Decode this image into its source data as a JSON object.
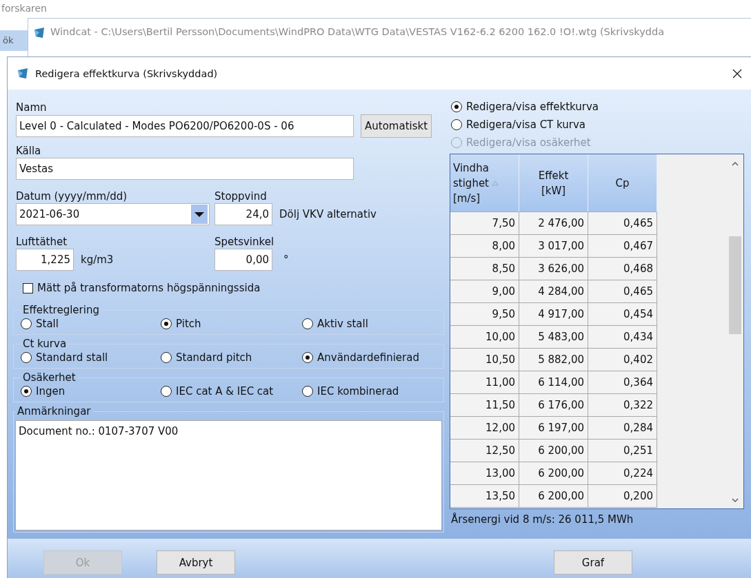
{
  "background": {
    "app_text": "forskaren",
    "side_text": "ök",
    "window_title": "Windcat - C:\\Users\\Bertil Persson\\Documents\\WindPRO Data\\WTG Data\\VESTAS V162-6.2 6200 162.0 !O!.wtg  (Skrivskydda"
  },
  "dialog": {
    "title": "Redigera effektkurva (Skrivskyddad)"
  },
  "name": {
    "label": "Namn",
    "value": "Level 0 - Calculated - Modes PO6200/PO6200-0S - 06",
    "button": "Automatiskt"
  },
  "source": {
    "label": "Källa",
    "value": "Vestas"
  },
  "date": {
    "label": "Datum (yyyy/mm/dd)",
    "value": "2021-06-30"
  },
  "stop_wind": {
    "label": "Stoppvind",
    "value": "24,0",
    "note": "Dölj VKV alternativ"
  },
  "air_density": {
    "label": "Lufttäthet",
    "value": "1,225",
    "unit": "kg/m3"
  },
  "tip_angle": {
    "label": "Spetsvinkel",
    "value": "0,00",
    "unit": "°"
  },
  "hv_side": {
    "label": "Mätt på transformatorns högspänningssida",
    "checked": false
  },
  "groups": [
    {
      "title": "Effektreglering",
      "options": [
        {
          "label": "Stall",
          "selected": false
        },
        {
          "label": "Pitch",
          "selected": true
        },
        {
          "label": "Aktiv stall",
          "selected": false
        }
      ]
    },
    {
      "title": "Ct kurva",
      "options": [
        {
          "label": "Standard stall",
          "selected": false
        },
        {
          "label": "Standard pitch",
          "selected": false
        },
        {
          "label": "Användardefinierad",
          "selected": true
        }
      ]
    },
    {
      "title": "Osäkerhet",
      "options": [
        {
          "label": "Ingen",
          "selected": true
        },
        {
          "label": "IEC cat A & IEC cat",
          "selected": false
        },
        {
          "label": "IEC kombinerad",
          "selected": false
        }
      ]
    }
  ],
  "remarks": {
    "title": "Anmärkningar",
    "value": "Document no.: 0107-3707 V00"
  },
  "view_options": [
    {
      "label": "Redigera/visa effektkurva",
      "selected": true,
      "disabled": false
    },
    {
      "label": "Redigera/visa CT kurva",
      "selected": false,
      "disabled": false
    },
    {
      "label": "Redigera/visa osäkerhet",
      "selected": false,
      "disabled": true
    }
  ],
  "table": {
    "columns": [
      {
        "lines": [
          "Vindha",
          "stighet",
          "[m/s]"
        ],
        "sorted": true
      },
      {
        "lines": [
          "Effekt",
          "[kW]"
        ],
        "sorted": false
      },
      {
        "lines": [
          "Cp"
        ],
        "sorted": false
      }
    ],
    "rows": [
      [
        "7,50",
        "2 476,00",
        "0,465"
      ],
      [
        "8,00",
        "3 017,00",
        "0,467"
      ],
      [
        "8,50",
        "3 626,00",
        "0,468"
      ],
      [
        "9,00",
        "4 284,00",
        "0,465"
      ],
      [
        "9,50",
        "4 917,00",
        "0,454"
      ],
      [
        "10,00",
        "5 483,00",
        "0,434"
      ],
      [
        "10,50",
        "5 882,00",
        "0,402"
      ],
      [
        "11,00",
        "6 114,00",
        "0,364"
      ],
      [
        "11,50",
        "6 176,00",
        "0,322"
      ],
      [
        "12,00",
        "6 197,00",
        "0,284"
      ],
      [
        "12,50",
        "6 200,00",
        "0,251"
      ],
      [
        "13,00",
        "6 200,00",
        "0,224"
      ],
      [
        "13,50",
        "6 200,00",
        "0,200"
      ]
    ]
  },
  "annual_energy": "Årsenergi vid 8 m/s: 26 011,5 MWh",
  "footer": {
    "left_buttons": [
      {
        "label": "Ok",
        "disabled": true
      },
      {
        "label": "Avbryt",
        "disabled": false
      }
    ],
    "right_buttons": [
      {
        "label": "Graf",
        "disabled": false
      }
    ]
  }
}
